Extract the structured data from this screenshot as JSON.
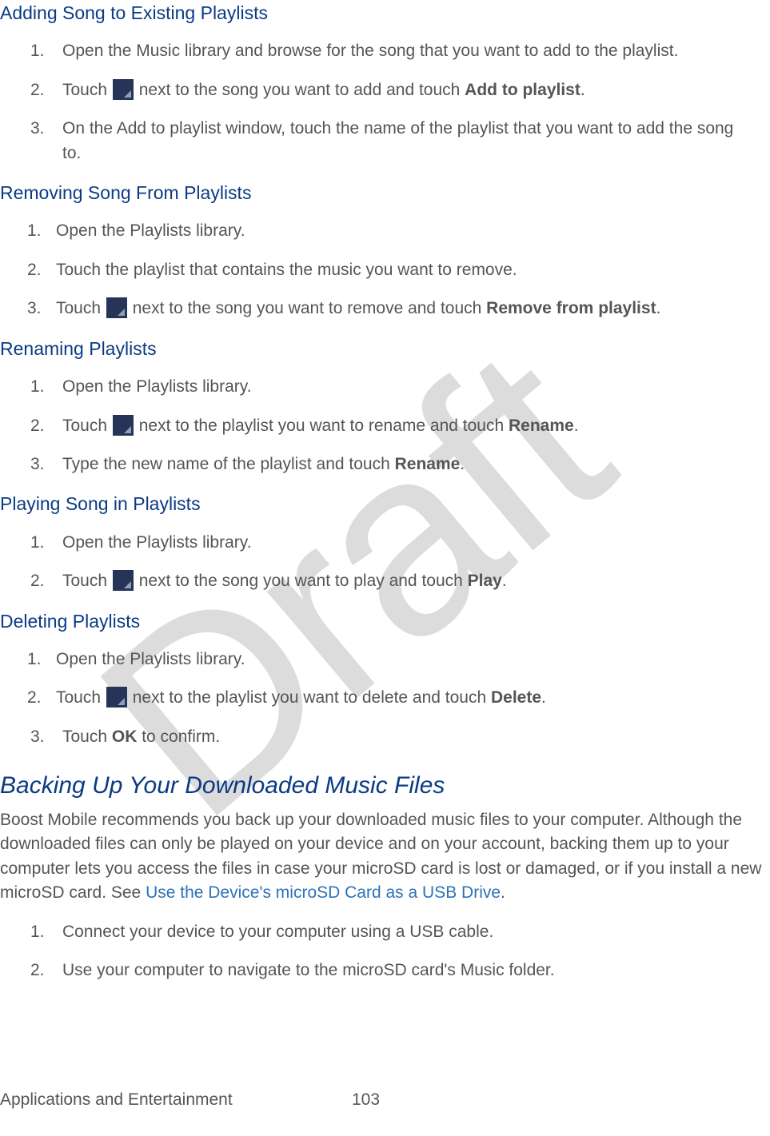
{
  "watermark": "Draft",
  "sections": {
    "add": {
      "title": "Adding Song to Existing Playlists",
      "step1": "Open the Music library and browse for the song that you want to add to the playlist.",
      "step2_a": "Touch ",
      "step2_b": " next to the song you want to add and touch ",
      "step2_bold": "Add to playlist",
      "step2_c": ".",
      "step3": "On the Add to playlist window, touch the name of the playlist that you want to add the song to."
    },
    "remove": {
      "title": "Removing Song From Playlists",
      "step1": "Open the Playlists library.",
      "step2": "Touch the playlist that contains the music you want to remove.",
      "step3_a": "Touch ",
      "step3_b": " next to the song you want to remove and touch ",
      "step3_bold": "Remove from playlist",
      "step3_c": "."
    },
    "rename": {
      "title": "Renaming Playlists",
      "step1": "Open the Playlists library.",
      "step2_a": "Touch ",
      "step2_b": " next to the playlist you want to rename and touch ",
      "step2_bold": "Rename",
      "step2_c": ".",
      "step3_a": "Type the new name of the playlist and touch ",
      "step3_bold": "Rename",
      "step3_c": "."
    },
    "play": {
      "title": "Playing Song in Playlists",
      "step1": "Open the Playlists library.",
      "step2_a": "Touch ",
      "step2_b": " next to the song you want to play and touch ",
      "step2_bold": "Play",
      "step2_c": "."
    },
    "delete": {
      "title": "Deleting Playlists",
      "step1": "Open the Playlists library.",
      "step2_a": "Touch ",
      "step2_b": " next to the playlist you want to delete and touch ",
      "step2_bold": "Delete",
      "step2_c": ".",
      "step3_a": " Touch ",
      "step3_bold": "OK",
      "step3_c": " to confirm."
    },
    "backup": {
      "title": "Backing Up Your Downloaded Music Files",
      "para_a": "Boost Mobile recommends you back up your downloaded music files to your computer. Although the downloaded files can only be played on your device and on your account, backing them up to your computer lets you access the files in case your microSD card is lost or damaged, or if you install a new microSD card. See ",
      "para_link": "Use the Device's microSD Card as a USB Drive",
      "para_b": ".",
      "step1": "Connect your device to your computer using a USB cable.",
      "step2": "Use your computer to navigate to the microSD card's Music folder."
    }
  },
  "numbers": {
    "n1": "1.",
    "n2": "2.",
    "n3": "3."
  },
  "footer": {
    "chapter": "Applications and Entertainment",
    "page": "103"
  }
}
